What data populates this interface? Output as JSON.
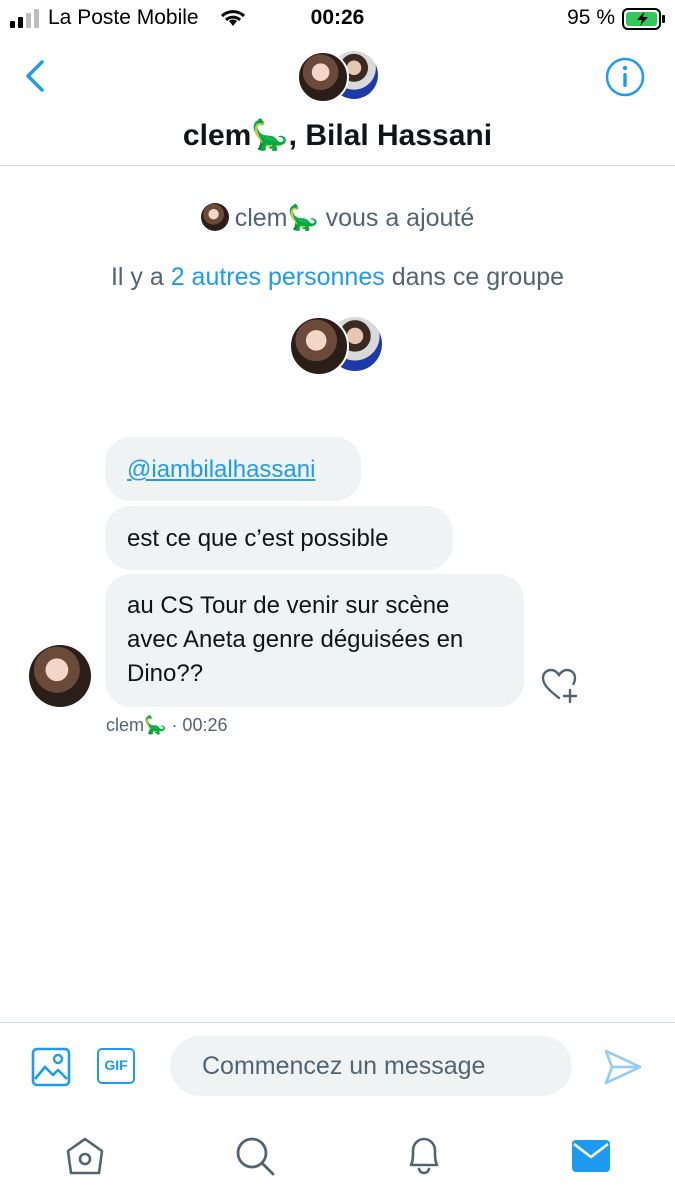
{
  "status_bar": {
    "carrier": "La Poste Mobile",
    "time": "00:26",
    "battery": "95 %"
  },
  "header": {
    "title": "clem🦕, Bilal Hassani"
  },
  "system": {
    "added_name": "clem🦕",
    "added_suffix": "vous a ajouté",
    "group_prefix": "Il y a",
    "group_link": "2 autres personnes",
    "group_suffix": "dans ce groupe"
  },
  "messages": [
    {
      "text": "@iambilalhassani",
      "is_mention": true
    },
    {
      "text": "est ce que c’est possible"
    },
    {
      "text": "au CS Tour de venir sur scène avec Aneta genre déguisées en Dino??"
    }
  ],
  "message_meta": {
    "sender": "clem🦕",
    "time": "· 00:26"
  },
  "composer": {
    "placeholder": "Commencez un message",
    "gif_label": "GIF"
  },
  "tabbar": {
    "items": [
      "home-icon",
      "search-icon",
      "notifications-icon",
      "messages-icon"
    ],
    "active": "messages-icon"
  },
  "colors": {
    "accent": "#1d9bf0",
    "bubble": "#eff3f4",
    "muted": "#536471"
  }
}
